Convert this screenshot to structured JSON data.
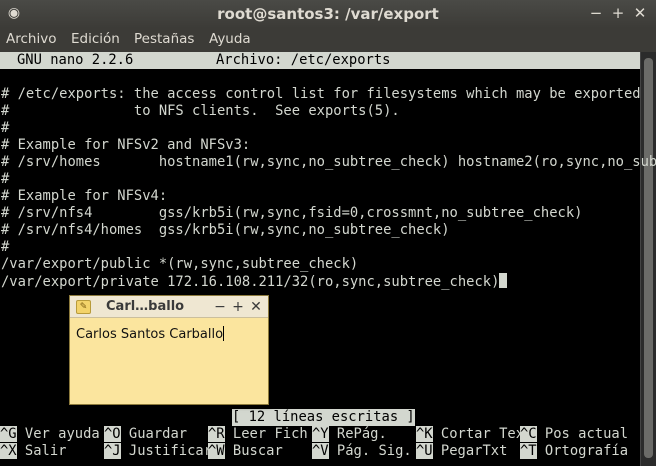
{
  "window": {
    "title": "root@santos3: /var/export",
    "minimize": "−",
    "maximize": "+",
    "close": "✕",
    "menu_icon": "◉"
  },
  "menubar": [
    "Archivo",
    "Edición",
    "Pestañas",
    "Ayuda"
  ],
  "nano": {
    "version": "GNU nano 2.2.6",
    "file": "Archivo: /etc/exports",
    "lines": [
      "",
      "# /etc/exports: the access control list for filesystems which may be exported",
      "#               to NFS clients.  See exports(5).",
      "#",
      "# Example for NFSv2 and NFSv3:",
      "# /srv/homes       hostname1(rw,sync,no_subtree_check) hostname2(ro,sync,no_sub$",
      "#",
      "# Example for NFSv4:",
      "# /srv/nfs4        gss/krb5i(rw,sync,fsid=0,crossmnt,no_subtree_check)",
      "# /srv/nfs4/homes  gss/krb5i(rw,sync,no_subtree_check)",
      "#",
      "/var/export/public *(rw,sync,subtree_check)",
      "/var/export/private 172.16.108.211/32(ro,sync,subtree_check)"
    ],
    "status": "[ 12 líneas escritas ]",
    "shortcuts_row1": [
      {
        "key": "^G",
        "label": " Ver ayuda"
      },
      {
        "key": "^O",
        "label": " Guardar"
      },
      {
        "key": "^R",
        "label": " Leer Fich"
      },
      {
        "key": "^Y",
        "label": " RePág."
      },
      {
        "key": "^K",
        "label": " Cortar Tex"
      },
      {
        "key": "^C",
        "label": " Pos actual"
      }
    ],
    "shortcuts_row2": [
      {
        "key": "^X",
        "label": " Salir"
      },
      {
        "key": "^J",
        "label": " Justificar"
      },
      {
        "key": "^W",
        "label": " Buscar"
      },
      {
        "key": "^V",
        "label": " Pág. Sig."
      },
      {
        "key": "^U",
        "label": " PegarTxt"
      },
      {
        "key": "^T",
        "label": " Ortografía"
      }
    ]
  },
  "sticky_note": {
    "title": "Carl…ballo",
    "minimize": "−",
    "add": "+",
    "close": "✕",
    "content": "Carlos Santos Carballo"
  }
}
